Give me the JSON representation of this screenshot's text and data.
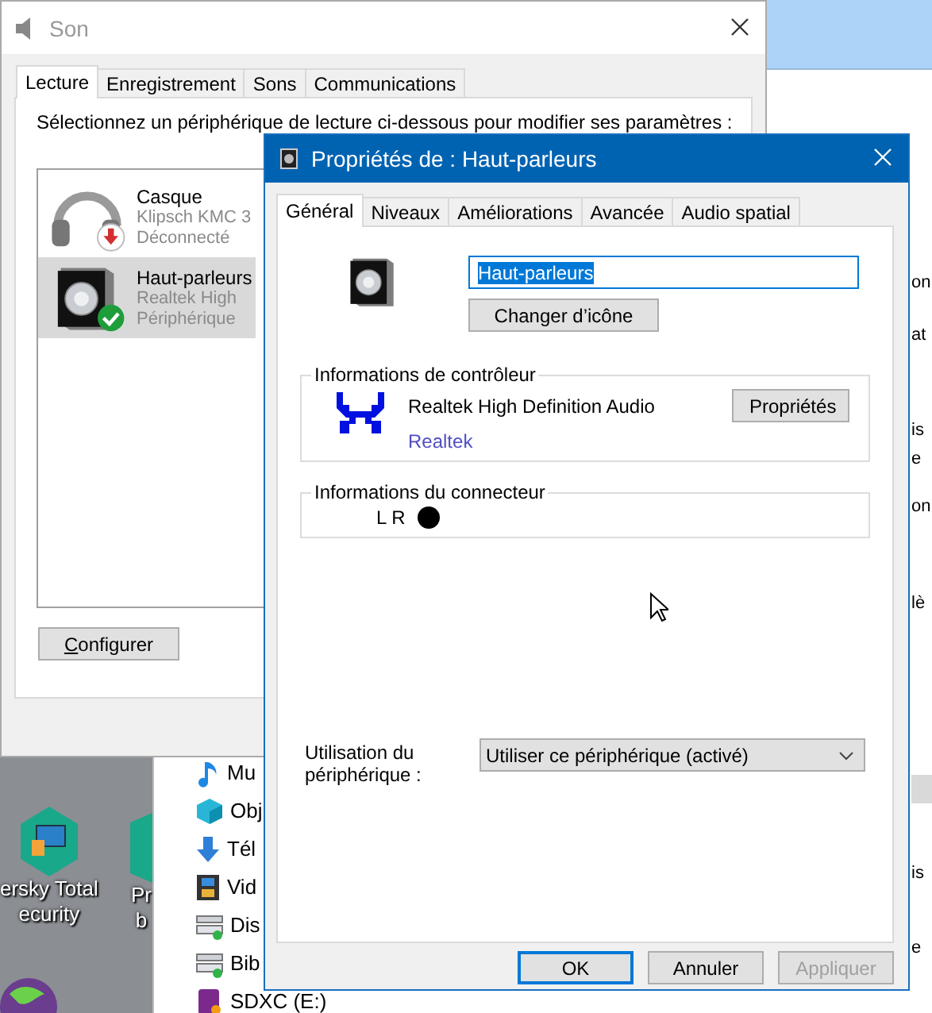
{
  "desktop": {
    "icons": [
      {
        "kind": "shield",
        "lines": [
          "ersky Total",
          "ecurity"
        ]
      },
      {
        "kind": "shortcut",
        "lines": [
          "Pr",
          "b"
        ]
      },
      {
        "kind": "globe"
      }
    ]
  },
  "explorer": {
    "items": [
      {
        "kind": "music",
        "label": "Mu"
      },
      {
        "kind": "cube",
        "label": "Obj"
      },
      {
        "kind": "download",
        "label": "Tél"
      },
      {
        "kind": "video",
        "label": "Vid"
      },
      {
        "kind": "drive",
        "label": "Dis"
      },
      {
        "kind": "drive",
        "label": "Bib"
      },
      {
        "kind": "sd",
        "label": "SDXC (E:)"
      }
    ],
    "right_fragments": [
      "on",
      "at",
      "is",
      "e",
      "on",
      "lè",
      "is",
      "e"
    ]
  },
  "sound_window": {
    "title": "Son",
    "tabs": [
      {
        "label": "Lecture",
        "selected": true
      },
      {
        "label": "Enregistrement",
        "selected": false
      },
      {
        "label": "Sons",
        "selected": false
      },
      {
        "label": "Communications",
        "selected": false
      }
    ],
    "instruction": "Sélectionnez un périphérique de lecture ci-dessous pour modifier ses paramètres :",
    "devices": [
      {
        "kind": "headphones",
        "disconnected": true,
        "default": false,
        "name": "Casque",
        "lines": [
          "Klipsch KMC 3",
          "Déconnecté"
        ],
        "selected": false
      },
      {
        "kind": "speaker",
        "disconnected": false,
        "default": true,
        "name": "Haut-parleurs",
        "lines": [
          "Realtek High",
          "Périphérique"
        ],
        "selected": true
      }
    ],
    "configure_button": "Configurer"
  },
  "properties_window": {
    "title": "Propriétés de : Haut-parleurs",
    "tabs": [
      {
        "label": "Général",
        "selected": true
      },
      {
        "label": "Niveaux",
        "selected": false
      },
      {
        "label": "Améliorations",
        "selected": false
      },
      {
        "label": "Avancée",
        "selected": false
      },
      {
        "label": "Audio spatial",
        "selected": false
      }
    ],
    "name_field": {
      "value": "Haut-parleurs",
      "text_selected": true
    },
    "change_icon_button": "Changer d’icône",
    "controller": {
      "legend": "Informations de contrôleur",
      "name": "Realtek High Definition Audio",
      "link": "Realtek",
      "button": "Propriétés"
    },
    "connector": {
      "legend": "Informations du connecteur",
      "channels": "L R"
    },
    "usage": {
      "label": "Utilisation du périphérique :",
      "value": "Utiliser ce périphérique (activé)"
    },
    "buttons": [
      {
        "label": "OK",
        "default": true,
        "disabled": false
      },
      {
        "label": "Annuler",
        "default": false,
        "disabled": false
      },
      {
        "label": "Appliquer",
        "default": false,
        "disabled": true
      }
    ]
  }
}
